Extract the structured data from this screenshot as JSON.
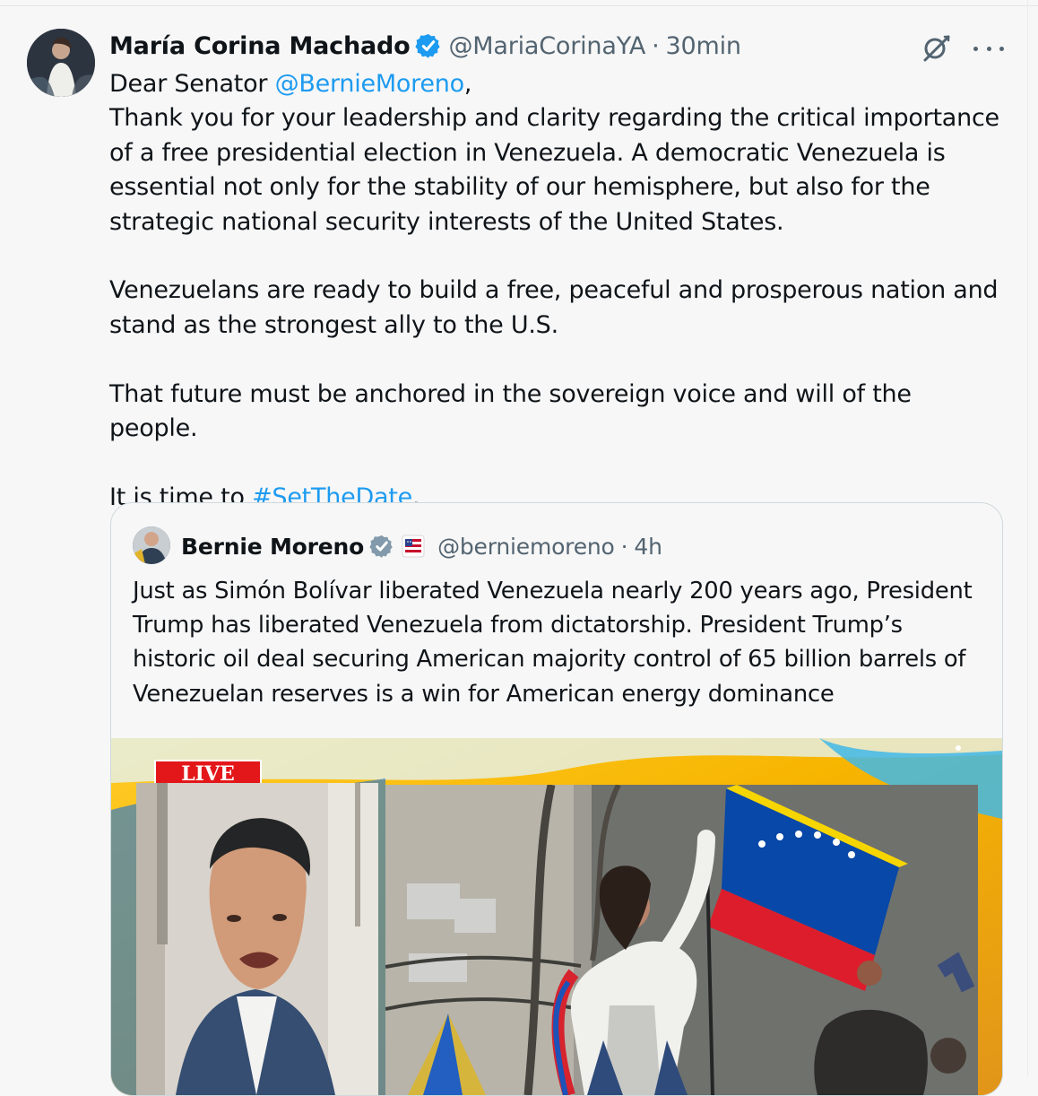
{
  "tweet": {
    "author_name": "María Corina Machado",
    "handle": "@MariaCorinaYA",
    "separator": "·",
    "time": "30min",
    "icons": {
      "avatar": "avatar-image",
      "verified": "verified-badge-icon",
      "grok": "grok-icon",
      "more": "more-options-icon"
    },
    "text": {
      "salutation_start": "Dear Senator ",
      "mention": "@BernieMoreno",
      "salutation_end": ",",
      "paragraph_1": "Thank you for your leadership and clarity regarding the critical importance of a free presidential election in Venezuela. A democratic Venezuela is essential not only for the stability of our hemisphere, but also for the strategic national security interests of the United States.",
      "paragraph_2": "Venezuelans are ready to build a free, peaceful and prosperous nation and stand as the strongest ally to the U.S.",
      "paragraph_3": "That future must be anchored in the sovereign voice and will of the people.",
      "closing_start": "It is time to ",
      "hashtag": "#SetTheDate",
      "closing_end": "."
    }
  },
  "quote": {
    "author_name": "Bernie Moreno",
    "handle": "@berniemoreno",
    "separator": "·",
    "time": "4h",
    "icons": {
      "avatar": "avatar-image",
      "verified": "gray-verified-badge-icon",
      "flag": "american-flag-icon"
    },
    "text": "Just as Simón Bolívar liberated Venezuela nearly 200 years ago, President Trump has liberated Venezuela from dictatorship. President Trump’s historic oil deal securing American majority control of 65 billion barrels of Venezuelan reserves is a win for American energy dominance",
    "media": {
      "badge": "LIVE",
      "description_icon": "video-thumbnail"
    }
  },
  "colors": {
    "text": "#0f1419",
    "secondary": "#536471",
    "link": "#1d9bf0",
    "verified": "#1d9bf0",
    "gray_verified": "#829aab",
    "background": "#f7f7f7",
    "border": "#cfd9de",
    "live": "#e3171a"
  }
}
